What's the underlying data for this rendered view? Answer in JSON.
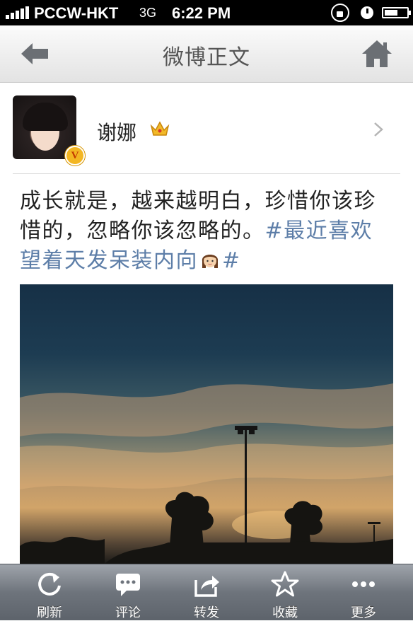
{
  "status_bar": {
    "carrier": "PCCW-HKT",
    "network": "3G",
    "time": "6:22 PM",
    "icons": [
      "signal-bars-icon",
      "rotation-lock-icon",
      "alarm-icon",
      "battery-icon"
    ]
  },
  "nav": {
    "title": "微博正文",
    "back_icon": "back-arrow-icon",
    "home_icon": "home-icon"
  },
  "author": {
    "name": "谢娜",
    "verified_badge": "V",
    "crown_icon": "crown-icon",
    "chevron_icon": "chevron-right-icon"
  },
  "post": {
    "text": "成长就是，越来越明白，珍惜你该珍惜的，忽略你该忽略的。",
    "hashtag_open": "#最近喜欢望着天发呆装内向",
    "emoji": "girl-face-emoji",
    "hashtag_close": "#",
    "image": "sunset-sky-photo"
  },
  "toolbar": {
    "items": [
      {
        "label": "刷新",
        "icon": "refresh-icon"
      },
      {
        "label": "评论",
        "icon": "comment-icon"
      },
      {
        "label": "转发",
        "icon": "forward-icon"
      },
      {
        "label": "收藏",
        "icon": "star-icon"
      },
      {
        "label": "更多",
        "icon": "more-icon"
      }
    ]
  },
  "colors": {
    "hashtag": "#5d7ea8",
    "toolbar": "#6e747c",
    "badge": "#f3b622"
  }
}
